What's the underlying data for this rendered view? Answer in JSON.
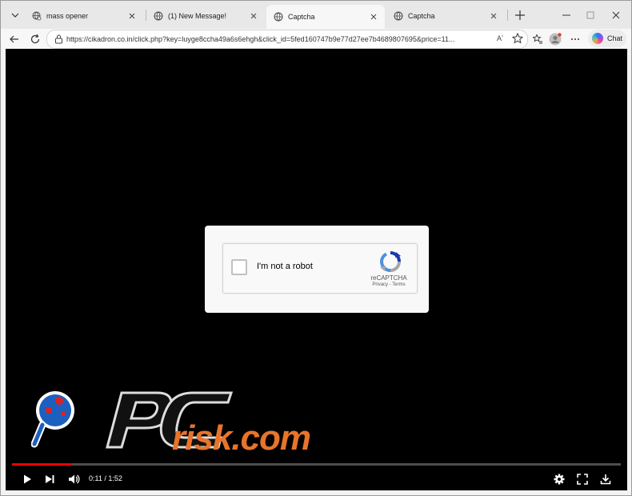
{
  "tabs": [
    {
      "title": "mass opener",
      "icon": "globe-search-icon",
      "active": false
    },
    {
      "title": "(1) New Message!",
      "icon": "globe-icon",
      "active": false
    },
    {
      "title": "Captcha",
      "icon": "globe-icon",
      "active": true
    },
    {
      "title": "Captcha",
      "icon": "globe-icon",
      "active": false
    }
  ],
  "address_bar": {
    "url": "https://cikadron.co.in/click.php?key=luyge8ccha49a6s6ehgh&click_id=5fed160747b9e77d27ee7b4689807695&price=11...",
    "read_aloud": "Aʼ"
  },
  "toolbar": {
    "copilot_label": "Chat"
  },
  "captcha": {
    "checkbox_label": "I'm not a robot",
    "brand": "reCAPTCHA",
    "privacy": "Privacy",
    "separator": " - ",
    "terms": "Terms"
  },
  "watermark": {
    "text": "risk.com",
    "pc_text": "PC"
  },
  "video": {
    "current_time": "0:11",
    "duration": "1:52",
    "time_display": "0:11 / 1:52",
    "progress": 0.098
  },
  "colors": {
    "accent_red": "#e00000",
    "watermark_orange": "#e8742a",
    "content_bg": "#000000"
  }
}
